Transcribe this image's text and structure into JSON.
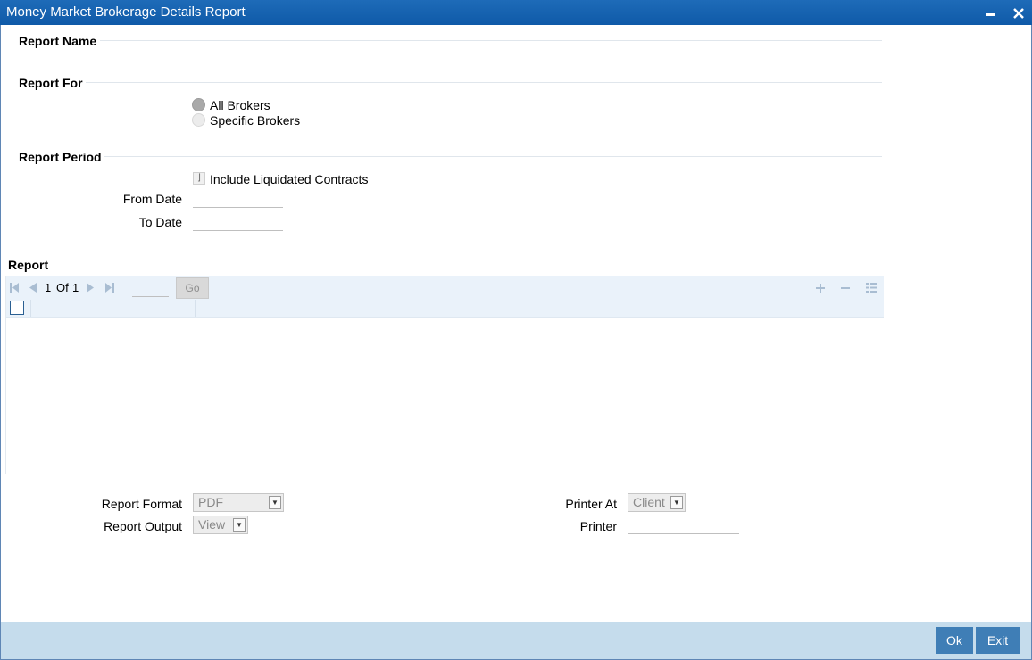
{
  "window": {
    "title": "Money Market Brokerage Details Report"
  },
  "sections": {
    "report_name": "Report Name",
    "report_for": "Report For",
    "report_period": "Report Period",
    "report": "Report"
  },
  "report_for": {
    "options": [
      "All Brokers",
      "Specific Brokers"
    ],
    "selected": "All Brokers"
  },
  "report_period": {
    "include_liquidated": "Include Liquidated Contracts",
    "from_date_label": "From Date",
    "to_date_label": "To Date",
    "from_date_value": "",
    "to_date_value": ""
  },
  "grid": {
    "page_current": "1",
    "page_of": "Of",
    "page_total": "1",
    "go_label": "Go"
  },
  "output": {
    "report_format_label": "Report Format",
    "report_format_value": "PDF",
    "report_output_label": "Report Output",
    "report_output_value": "View",
    "printer_at_label": "Printer At",
    "printer_at_value": "Client",
    "printer_label": "Printer",
    "printer_value": ""
  },
  "buttons": {
    "ok": "Ok",
    "exit": "Exit"
  }
}
